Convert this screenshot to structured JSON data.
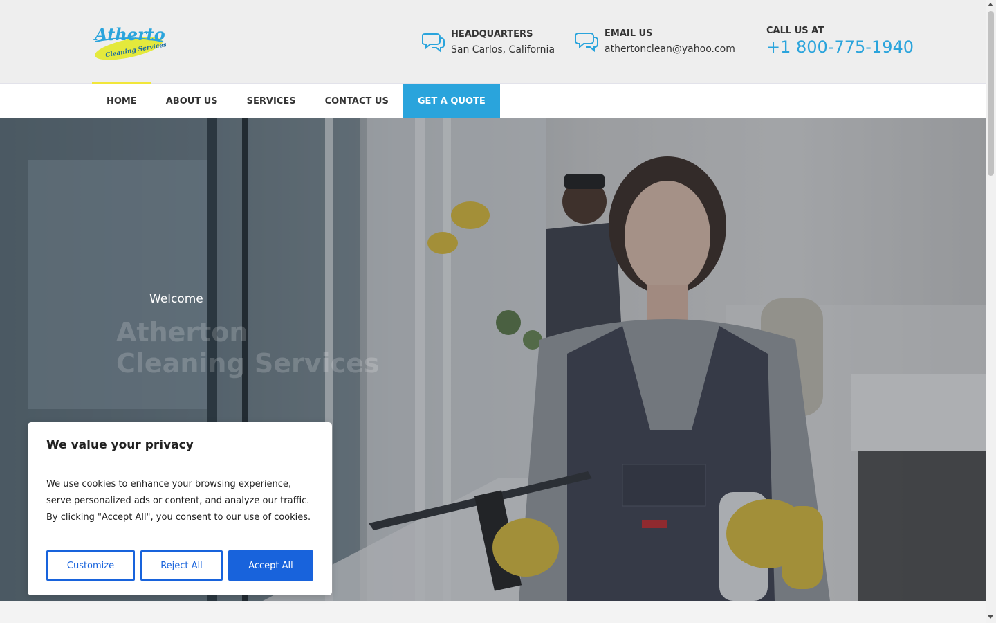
{
  "header": {
    "logo": {
      "line1": "Atherton",
      "line2": "Cleaning Services"
    },
    "headquarters": {
      "label": "HEADQUARTERS",
      "value": "San Carlos, California",
      "icon": "chat-bubbles-icon"
    },
    "email": {
      "label": "EMAIL US",
      "value": "athertonclean@yahoo.com",
      "icon": "chat-bubbles-icon"
    },
    "call": {
      "label": "CALL US AT",
      "phone": "+1 800-775-1940"
    }
  },
  "nav": {
    "items": [
      {
        "label": "HOME",
        "active": true
      },
      {
        "label": "ABOUT US"
      },
      {
        "label": "SERVICES"
      },
      {
        "label": "CONTACT US"
      }
    ],
    "quote": "GET A QUOTE"
  },
  "hero": {
    "welcome": "Welcome",
    "title": "Atherton\nCleaning Services"
  },
  "cookie": {
    "title": "We value your privacy",
    "text": "We use cookies to enhance your browsing experience, serve personalized ads or content, and analyze our traffic. By clicking \"Accept All\", you consent to our use of cookies.",
    "customize": "Customize",
    "reject": "Reject All",
    "accept": "Accept All"
  },
  "colors": {
    "accent": "#2aa4dc",
    "highlight": "#f1e63a",
    "consent_blue": "#1863dc"
  }
}
